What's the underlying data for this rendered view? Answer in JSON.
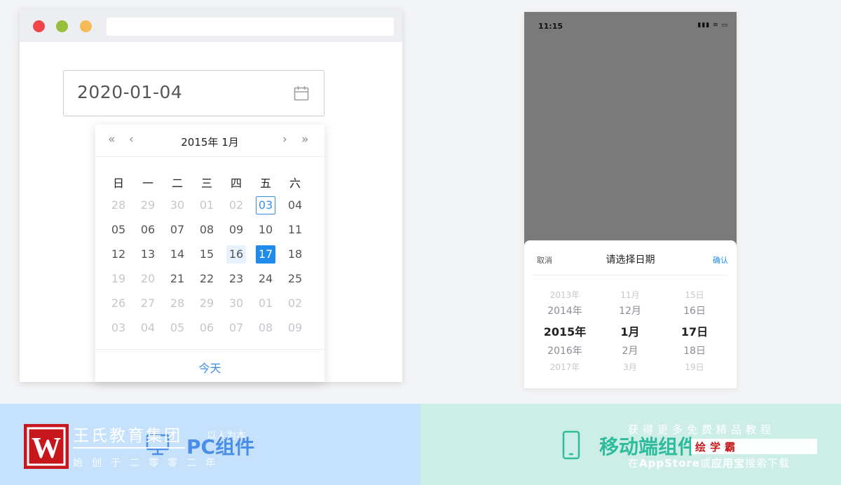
{
  "pc_demo": {
    "date_input_value": "2020-01-04",
    "calendar": {
      "title": "2015年 1月",
      "nav": {
        "prev_year": "«",
        "prev_month": "‹",
        "next_month": "›",
        "next_year": "»"
      },
      "weekdays": [
        "日",
        "一",
        "二",
        "三",
        "四",
        "五",
        "六"
      ],
      "days": [
        [
          "28",
          "29",
          "30",
          "01",
          "02",
          "03",
          "04"
        ],
        [
          "05",
          "06",
          "07",
          "08",
          "09",
          "10",
          "11"
        ],
        [
          "12",
          "13",
          "14",
          "15",
          "16",
          "17",
          "18"
        ],
        [
          "19",
          "20",
          "21",
          "22",
          "23",
          "24",
          "25"
        ],
        [
          "26",
          "27",
          "28",
          "29",
          "30",
          "01",
          "02"
        ],
        [
          "03",
          "04",
          "05",
          "06",
          "07",
          "08",
          "09"
        ]
      ],
      "today_button": "今天"
    },
    "label": "PC组件"
  },
  "mobile_demo": {
    "status_time": "11:15",
    "status_icons": "▮▮▮ ≋ ▭",
    "sheet_title": "请选择日期",
    "cancel": "取消",
    "confirm": "确认",
    "year_options": [
      "2013年",
      "2014年",
      "2015年",
      "2016年",
      "2017年"
    ],
    "month_options": [
      "11月",
      "12月",
      "1月",
      "2月",
      "3月"
    ],
    "day_options": [
      "15日",
      "16日",
      "17日",
      "18日",
      "19日"
    ],
    "label": "移动端组件"
  },
  "watermark": {
    "logo_letter": "W",
    "brand": "王氏教育集团",
    "motto": "以人为本",
    "founded": "始创于二零零二年",
    "promo_line1": "获得更多免费精品教程",
    "badge": "绘学霸",
    "promo_prefix": "在",
    "promo_store1": "AppStore",
    "promo_or": "或",
    "promo_store2": "应用宝",
    "promo_suffix": "搜索下载"
  },
  "colors": {
    "accent_blue": "#1f8ceb",
    "mobile_green": "#2fbc9c",
    "logo_red": "#c8161d"
  }
}
